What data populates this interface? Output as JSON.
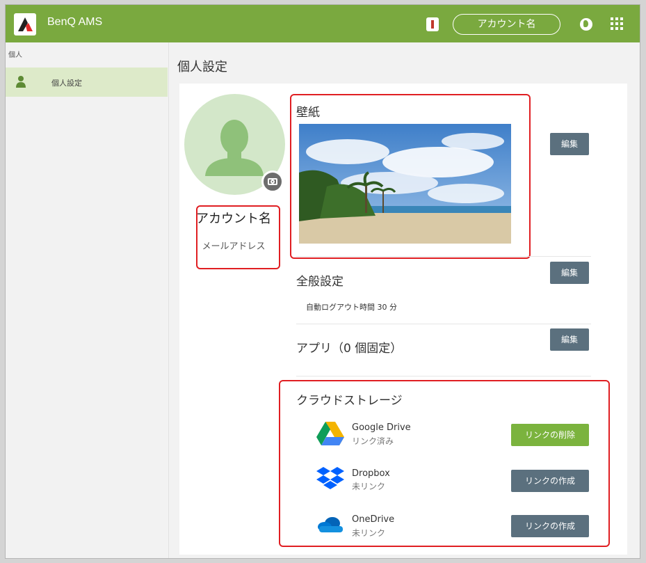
{
  "topbar": {
    "app_title": "BenQ AMS",
    "account_label": "アカウント名"
  },
  "sidebar": {
    "section_label": "個人",
    "items": [
      {
        "label": "個人設定"
      }
    ]
  },
  "main": {
    "page_title": "個人設定",
    "profile": {
      "account_name": "アカウント名",
      "email": "メールアドレス"
    },
    "wallpaper": {
      "title": "壁紙",
      "edit_label": "編集"
    },
    "general": {
      "title": "全般設定",
      "auto_logout": "自動ログアウト時間 30 分",
      "edit_label": "編集"
    },
    "apps": {
      "title": "アプリ（0 個固定）",
      "edit_label": "編集"
    },
    "cloud": {
      "title": "クラウドストレージ",
      "services": [
        {
          "name": "Google Drive",
          "status": "リンク済み",
          "action": "リンクの削除",
          "action_color": "#7bb33e"
        },
        {
          "name": "Dropbox",
          "status": "未リンク",
          "action": "リンクの作成",
          "action_color": "#5b707e"
        },
        {
          "name": "OneDrive",
          "status": "未リンク",
          "action": "リンクの作成",
          "action_color": "#5b707e"
        }
      ]
    }
  },
  "colors": {
    "brand_green": "#7aa93f",
    "highlight_red": "#e01e22",
    "button_gray": "#5b707e"
  }
}
